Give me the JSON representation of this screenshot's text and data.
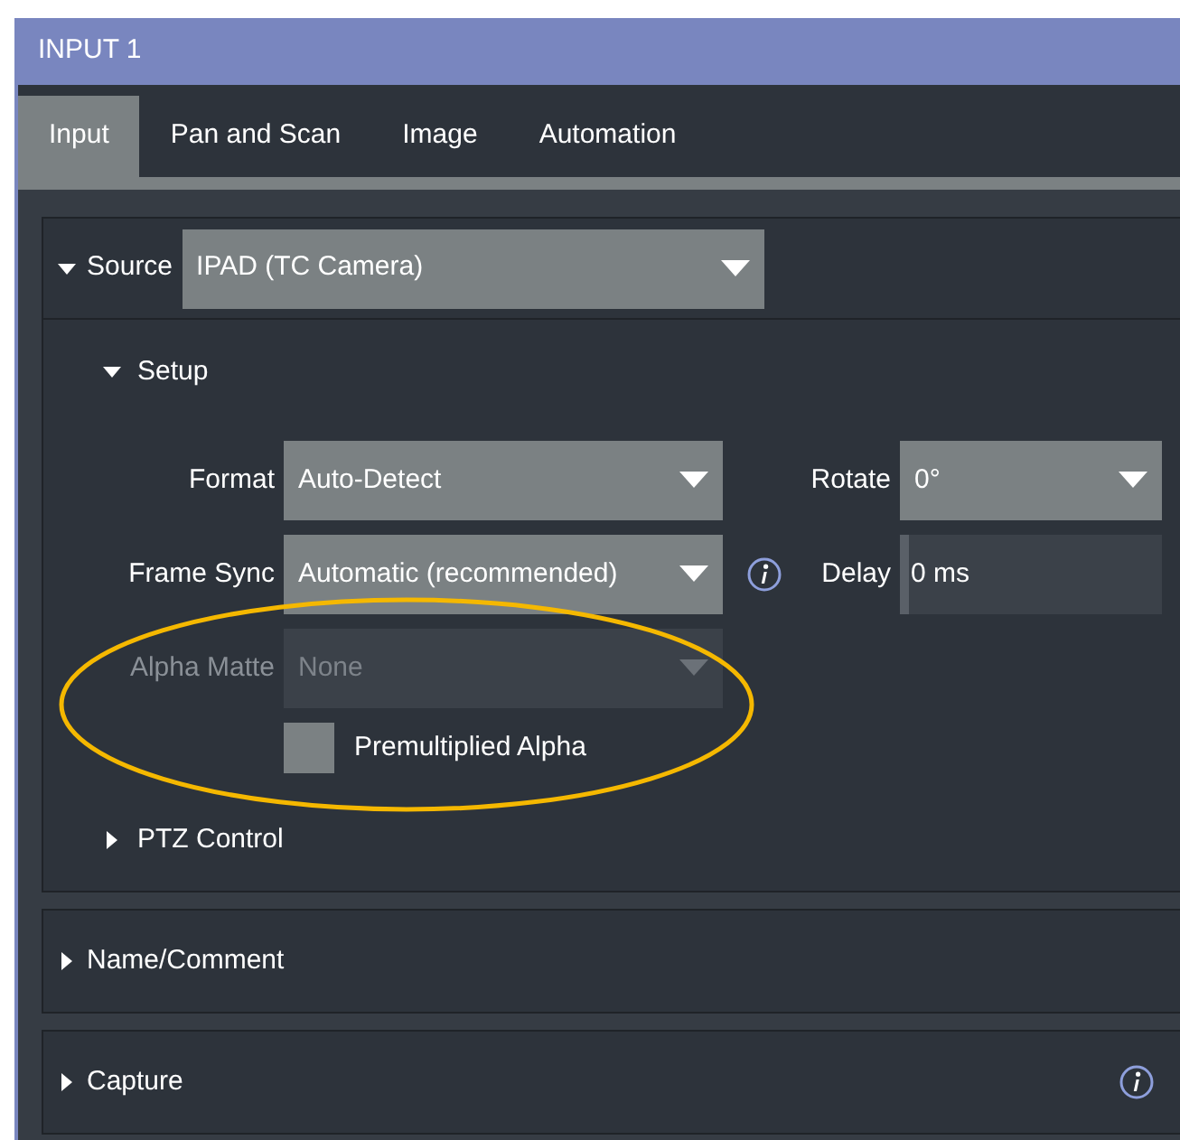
{
  "window": {
    "title": "INPUT 1"
  },
  "tabs": [
    {
      "label": "Input",
      "selected": true
    },
    {
      "label": "Pan and Scan",
      "selected": false
    },
    {
      "label": "Image",
      "selected": false
    },
    {
      "label": "Automation",
      "selected": false
    }
  ],
  "sections": [
    {
      "title": "Source",
      "expanded": true,
      "value": "IPAD (TC Camera)",
      "groups": [
        {
          "title": "Setup",
          "expanded": true,
          "rows": [
            [
              {
                "kind": "dropdown",
                "label": "Format",
                "value": "Auto-Detect",
                "disabled": false
              },
              {
                "kind": "dropdown",
                "label": "Rotate",
                "value": "0°",
                "disabled": false
              }
            ],
            [
              {
                "kind": "dropdown",
                "label": "Frame Sync",
                "value": "Automatic (recommended)",
                "disabled": false,
                "info": true
              },
              {
                "kind": "text",
                "label": "Delay",
                "value": "0 ms",
                "disabled": false
              }
            ],
            [
              {
                "kind": "dropdown",
                "label": "Alpha Matte",
                "value": "None",
                "disabled": true
              }
            ],
            [
              {
                "kind": "checkbox",
                "label": "Premultiplied Alpha",
                "checked": false
              }
            ]
          ]
        },
        {
          "title": "PTZ Control",
          "expanded": false
        }
      ]
    },
    {
      "title": "Name/Comment",
      "expanded": false
    },
    {
      "title": "Capture",
      "expanded": false,
      "info": true
    }
  ]
}
